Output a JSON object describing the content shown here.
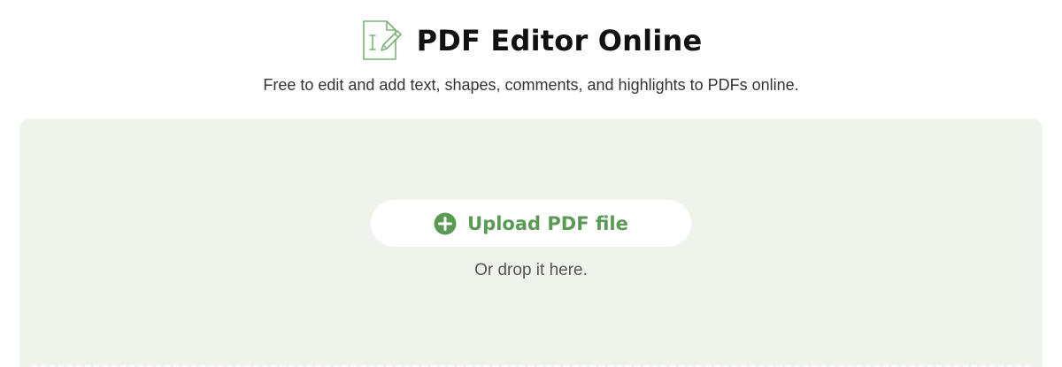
{
  "header": {
    "title": "PDF Editor Online",
    "logo_icon": "pdf-edit-document-icon",
    "subtitle": "Free to edit and add text, shapes, comments, and highlights to PDFs online."
  },
  "upload": {
    "button_label": "Upload PDF file",
    "button_icon": "plus-circle-icon",
    "drop_hint": "Or drop it here."
  },
  "colors": {
    "accent": "#5a9a55",
    "drop_zone_background": "#eef4ec",
    "title_text": "#111111",
    "body_text": "#333333"
  }
}
